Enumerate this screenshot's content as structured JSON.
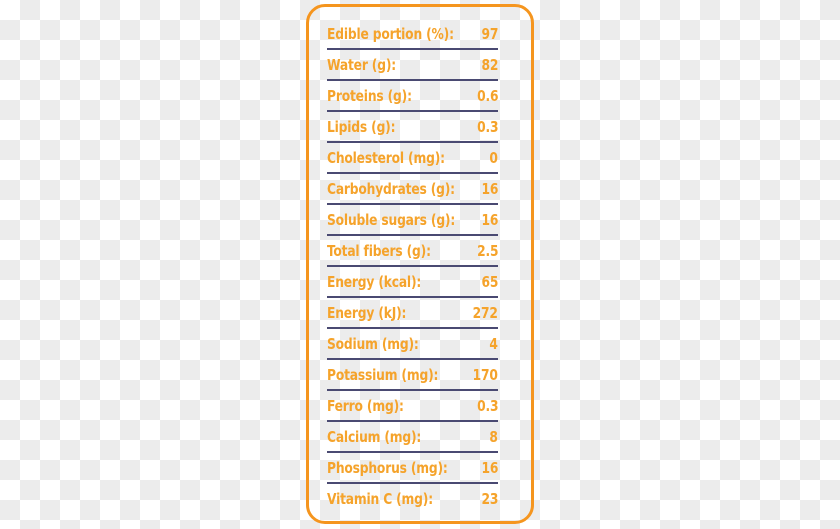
{
  "panel": {
    "border_color": "#f5951e",
    "text_color": "#f5a32b",
    "rule_color": "#4a4a72"
  },
  "nutrition_table": {
    "rows": [
      {
        "label": "Edible portion (%):",
        "value": "97"
      },
      {
        "label": "Water (g):",
        "value": "82"
      },
      {
        "label": "Proteins (g):",
        "value": "0.6"
      },
      {
        "label": "Lipids (g):",
        "value": "0.3"
      },
      {
        "label": "Cholesterol (mg):",
        "value": "0"
      },
      {
        "label": "Carbohydrates (g):",
        "value": "16"
      },
      {
        "label": "Soluble sugars (g):",
        "value": "16"
      },
      {
        "label": "Total fibers (g):",
        "value": "2.5"
      },
      {
        "label": "Energy (kcal):",
        "value": "65"
      },
      {
        "label": "Energy (kJ):",
        "value": "272"
      },
      {
        "label": "Sodium (mg):",
        "value": "4"
      },
      {
        "label": "Potassium (mg):",
        "value": "170"
      },
      {
        "label": "Ferro (mg):",
        "value": "0.3"
      },
      {
        "label": "Calcium (mg):",
        "value": "8"
      },
      {
        "label": "Phosphorus (mg):",
        "value": "16"
      },
      {
        "label": "Vitamin C (mg):",
        "value": "23"
      }
    ]
  }
}
